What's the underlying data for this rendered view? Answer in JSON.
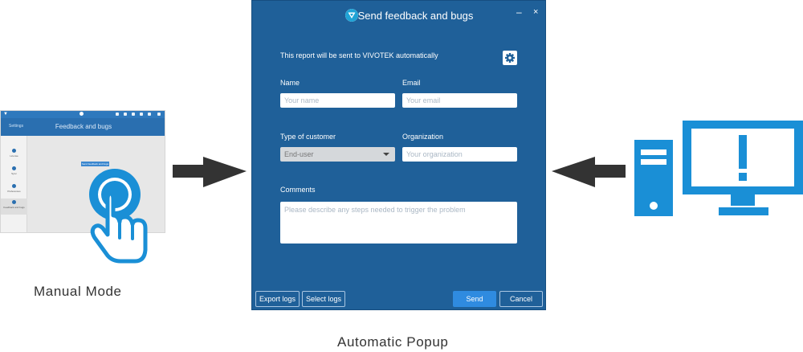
{
  "thumbnail": {
    "header_title": "Feedback and bugs",
    "back_label": "Settings",
    "sidebar_items": [
      "License",
      "Sync",
      "Preferences",
      "Feedback and bugs"
    ],
    "center_button": "Send feedback and bugs"
  },
  "manual_caption": "Manual Mode",
  "auto_caption": "Automatic Popup",
  "popup": {
    "title": "Send feedback and bugs",
    "notice": "This report will be sent to VIVOTEK automatically",
    "name_label": "Name",
    "name_placeholder": "Your name",
    "email_label": "Email",
    "email_placeholder": "Your email",
    "customer_label": "Type of customer",
    "customer_value": "End-user",
    "org_label": "Organization",
    "org_placeholder": "Your organization",
    "comments_label": "Comments",
    "comments_placeholder": "Please describe any steps needed to trigger the problem",
    "export_button": "Export logs",
    "select_button": "Select logs",
    "send_button": "Send",
    "cancel_button": "Cancel",
    "minimize_glyph": "–",
    "close_glyph": "×"
  },
  "colors": {
    "popup_bg": "#1f6099",
    "accent_blue": "#1a8fd6",
    "send_button": "#2f8be0",
    "arrow": "#333333"
  },
  "icons": [
    "vivotek-logo-icon",
    "gear-icon",
    "tap-hand-icon",
    "computer-alert-icon",
    "arrow-right-icon",
    "arrow-left-icon"
  ]
}
